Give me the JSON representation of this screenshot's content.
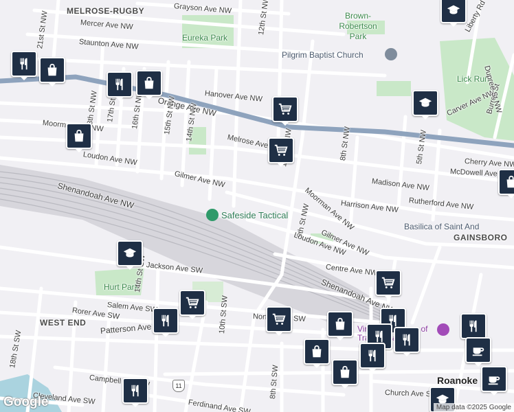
{
  "neighborhoods": [
    "MELROSE-RUGBY",
    "WEST END",
    "GAINSBORO"
  ],
  "parks": [
    "Eureka Park",
    "Brown-Robertson Park",
    "Lick Run",
    "Hurt Park"
  ],
  "places": {
    "church": "Pilgrim Baptist Church",
    "tactical": "Safeside Tactical",
    "basilica": "Basilica of Saint And",
    "museum": "Virginia Museum of Transportation",
    "roanoke": "Roanoke"
  },
  "streets": [
    "Grayson Ave NW",
    "Mercer Ave NW",
    "Staunton Ave NW",
    "Orange Ave NW",
    "Hanover Ave NW",
    "Moorman Ave NW",
    "Loudon Ave NW",
    "Melrose Ave NW",
    "Gilmer Ave NW",
    "Shenandoah Ave NW",
    "Madison Ave NW",
    "Harrison Ave NW",
    "Rutherford Ave NW",
    "Cherry Ave NW",
    "McDowell Ave NW",
    "Carver Ave NW",
    "Centre Ave NW",
    "Jackson Ave SW",
    "Salem Ave SW",
    "Rorer Ave SW",
    "Patterson Ave SW",
    "Norfolk Ave SW",
    "Campbell Ave SW",
    "Cleveland Ave SW",
    "Ferdinand Ave SW",
    "Church Ave SW",
    "21st St NW",
    "18th St NW",
    "17th St NW",
    "16th St NW",
    "15th St NW",
    "14th St NW",
    "12th St NW",
    "10th St NW",
    "9th St NW",
    "8th St NW",
    "5th St NW",
    "14th St SW",
    "10th St SW",
    "18th St SW",
    "8th St SW",
    "Liberty Rd NW",
    "Burrell St",
    "Dupree St NW",
    "Moorman Ave NW",
    "Gilmer Ave NW",
    "Loudon Ave NW",
    "Shenandoah Ave NW"
  ],
  "highway_shield": "11",
  "attribution": "Map data ©2025 Google",
  "logo": "Google",
  "colors": {
    "background": "#f1f0f4",
    "park": "#c9e8c8",
    "rail": "#c8c8cc",
    "arterial": "#8ea3bd",
    "pin": "#1f2f45",
    "water": "#aad3df",
    "poi_green": "#2f9a6a",
    "poi_gray": "#7f8c9c",
    "poi_purple": "#a24bb8"
  },
  "markers": [
    {
      "type": "restaurant",
      "x": 0
    },
    {
      "type": "shopping",
      "x": 0
    }
  ]
}
